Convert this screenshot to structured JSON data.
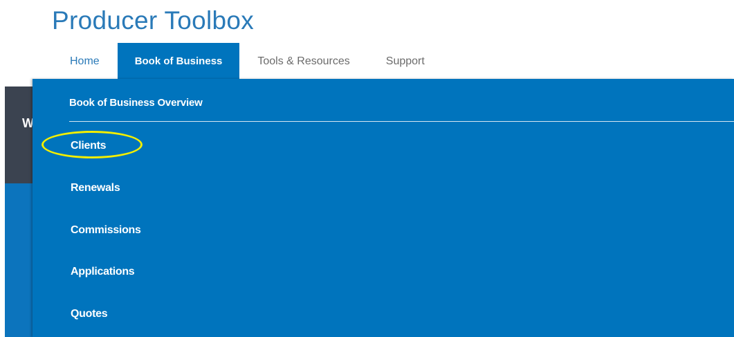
{
  "app": {
    "title": "Producer Toolbox"
  },
  "nav": {
    "tabs": [
      {
        "label": "Home",
        "state": "link"
      },
      {
        "label": "Book of Business",
        "state": "active"
      },
      {
        "label": "Tools & Resources",
        "state": "normal"
      },
      {
        "label": "Support",
        "state": "normal"
      }
    ]
  },
  "background": {
    "partial_letter": "W"
  },
  "dropdown": {
    "header": "Book of Business Overview",
    "items": [
      {
        "label": "Clients",
        "highlighted": true
      },
      {
        "label": "Renewals",
        "highlighted": false
      },
      {
        "label": "Commissions",
        "highlighted": false
      },
      {
        "label": "Applications",
        "highlighted": false
      },
      {
        "label": "Quotes",
        "highlighted": false
      }
    ]
  },
  "colors": {
    "brand_blue": "#0074bd",
    "title_blue": "#2a7ab8",
    "highlight_yellow": "#f3ee00",
    "dark_panel": "#3b4350"
  }
}
